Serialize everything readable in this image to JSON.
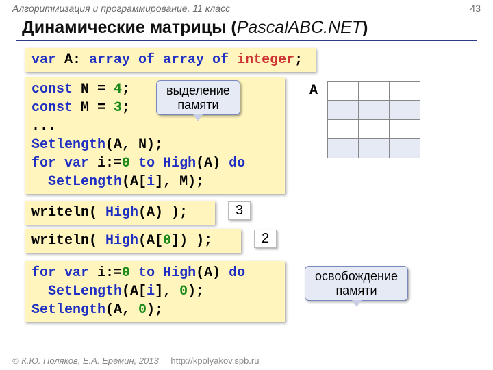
{
  "header": "Алгоритмизация и программирование, 11 класс",
  "page_num": "43",
  "title_main": "Динамические матрицы ",
  "title_paren_open": "(",
  "title_pascal": "PascalABC.NET",
  "title_paren_close": ")",
  "code1": {
    "p": [
      {
        "t": "var",
        "c": "kw"
      },
      {
        "t": " A: "
      },
      {
        "t": "array of array of",
        "c": "kw"
      },
      {
        "t": " "
      },
      {
        "t": "integer",
        "c": "type"
      },
      {
        "t": ";"
      }
    ]
  },
  "code2": {
    "lines": [
      [
        {
          "t": "const",
          "c": "kw"
        },
        {
          "t": " N = "
        },
        {
          "t": "4",
          "c": "num"
        },
        {
          "t": ";"
        }
      ],
      [
        {
          "t": "const",
          "c": "kw"
        },
        {
          "t": " M = "
        },
        {
          "t": "3",
          "c": "num"
        },
        {
          "t": ";"
        }
      ],
      [
        {
          "t": "..."
        }
      ],
      [
        {
          "t": "Setlength",
          "c": "ident-blue"
        },
        {
          "t": "(A, N);"
        }
      ],
      [
        {
          "t": "for var",
          "c": "kw"
        },
        {
          "t": " i:="
        },
        {
          "t": "0",
          "c": "num"
        },
        {
          "t": " "
        },
        {
          "t": "to",
          "c": "kw"
        },
        {
          "t": " "
        },
        {
          "t": "High",
          "c": "ident-blue"
        },
        {
          "t": "(A) "
        },
        {
          "t": "do",
          "c": "kw"
        }
      ],
      [
        {
          "t": "  "
        },
        {
          "t": "SetLength",
          "c": "ident-blue"
        },
        {
          "t": "(A["
        },
        {
          "t": "i",
          "c": "ident-blue"
        },
        {
          "t": "], M);"
        }
      ]
    ]
  },
  "callout_alloc": "выделение\nпамяти",
  "callout_free": "освобождение\nпамяти",
  "matrix_label": "A",
  "code3": {
    "p": [
      {
        "t": "writeln( "
      },
      {
        "t": "High",
        "c": "ident-blue"
      },
      {
        "t": "(A) );"
      }
    ]
  },
  "result3": "3",
  "code4": {
    "p": [
      {
        "t": "writeln( "
      },
      {
        "t": "High",
        "c": "ident-blue"
      },
      {
        "t": "(A["
      },
      {
        "t": "0",
        "c": "num"
      },
      {
        "t": "]) );"
      }
    ]
  },
  "result4": "2",
  "code5": {
    "lines": [
      [
        {
          "t": "for var",
          "c": "kw"
        },
        {
          "t": " i:="
        },
        {
          "t": "0",
          "c": "num"
        },
        {
          "t": " "
        },
        {
          "t": "to",
          "c": "kw"
        },
        {
          "t": " "
        },
        {
          "t": "High",
          "c": "ident-blue"
        },
        {
          "t": "(A) "
        },
        {
          "t": "do",
          "c": "kw"
        }
      ],
      [
        {
          "t": "  "
        },
        {
          "t": "SetLength",
          "c": "ident-blue"
        },
        {
          "t": "(A["
        },
        {
          "t": "i",
          "c": "ident-blue"
        },
        {
          "t": "], "
        },
        {
          "t": "0",
          "c": "num"
        },
        {
          "t": ");"
        }
      ],
      [
        {
          "t": "Setlength",
          "c": "ident-blue"
        },
        {
          "t": "(A, "
        },
        {
          "t": "0",
          "c": "num"
        },
        {
          "t": ");"
        }
      ]
    ]
  },
  "footer_auth": "© К.Ю. Поляков, Е.А. Ерёмин, 2013",
  "footer_url": "http://kpolyakov.spb.ru"
}
